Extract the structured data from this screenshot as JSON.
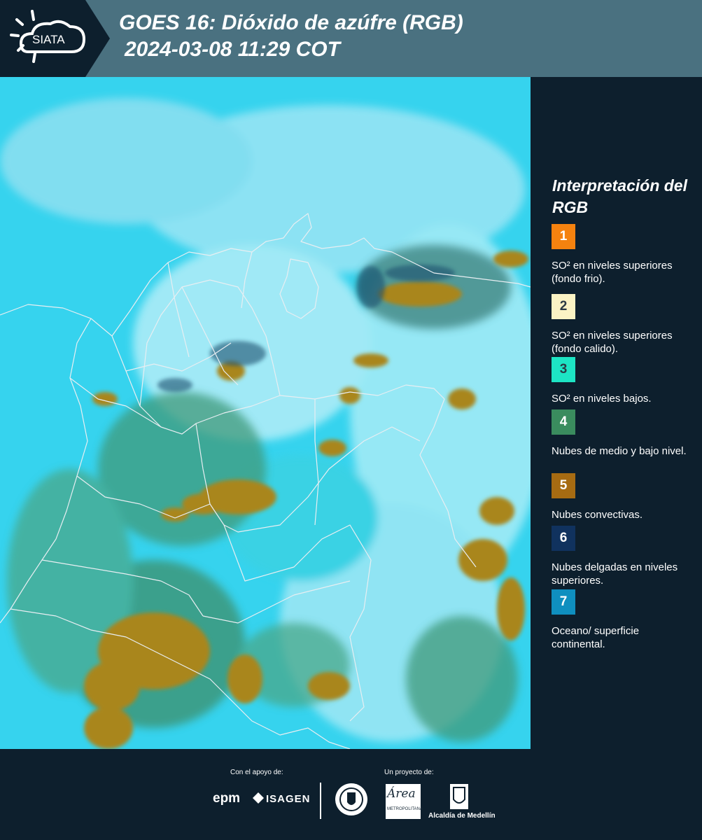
{
  "header": {
    "logo_text": "SIATA",
    "title_line1": "GOES 16: Dióxido de azúfre (RGB)",
    "title_line2": "2024-03-08 11:29 COT",
    "background_color": "#4a7180"
  },
  "legend": {
    "title": "Interpretación del RGB",
    "items": [
      {
        "number": "1",
        "label": "SO² en niveles superiores (fondo frio).",
        "color": "#f5820f",
        "text_color": "#ffffff"
      },
      {
        "number": "2",
        "label": "SO² en niveles superiores (fondo calido).",
        "color": "#fbf3c4",
        "text_color": "#2b3a44"
      },
      {
        "number": "3",
        "label": "SO² en niveles bajos.",
        "color": "#1de5c4",
        "text_color": "#2b3a44"
      },
      {
        "number": "4",
        "label": "Nubes de medio y bajo nivel.",
        "color": "#3a8c5e",
        "text_color": "#ffffff"
      },
      {
        "number": "5",
        "label": "Nubes convectivas.",
        "color": "#a66b12",
        "text_color": "#ffffff"
      },
      {
        "number": "6",
        "label": "Nubes delgadas en niveles superiores.",
        "color": "#10325e",
        "text_color": "#ffffff"
      },
      {
        "number": "7",
        "label": "Oceano/ superficie continental.",
        "color": "#0f8fbf",
        "text_color": "#ffffff"
      }
    ]
  },
  "footer": {
    "support_caption": "Con el apoyo de:",
    "project_caption": "Un proyecto de:",
    "sponsor_epm": "epm",
    "sponsor_isagen": "ISAGEN",
    "area_logo_text": "Área",
    "area_logo_sub": "METROPOLITANA",
    "alcaldia_text": "Alcaldía de Medellín"
  },
  "map": {
    "ocean_color": "#2fd4f2",
    "land_color": "#3fc6cf",
    "cloud_color": "#a6e9f6",
    "convective_color": "#a8841e",
    "lowcloud_color": "#3b8a6a",
    "border_color": "#e8eef2"
  }
}
